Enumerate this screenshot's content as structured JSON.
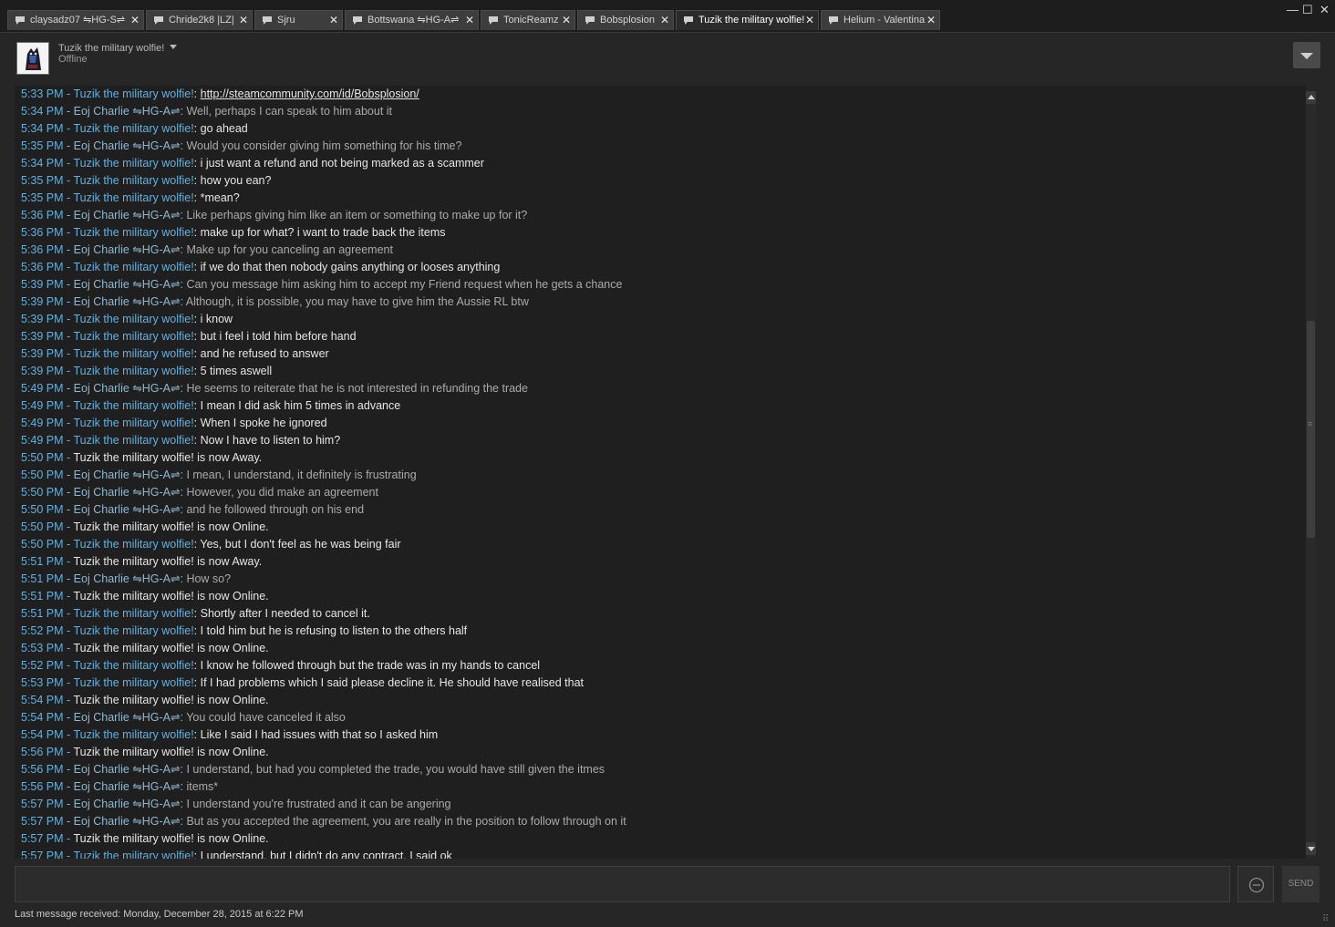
{
  "tabs": [
    {
      "label": "claysadz07 ⇋HG-S⇌",
      "width": 150,
      "active": false
    },
    {
      "label": "Chride2k8 |LZ|",
      "width": 117,
      "active": false
    },
    {
      "label": "Sjru",
      "width": 97,
      "active": false
    },
    {
      "label": "Bottswana ⇋HG-A⇌",
      "width": 147,
      "active": false
    },
    {
      "label": "TonicReamz",
      "width": 104,
      "active": false
    },
    {
      "label": "Bobsplosion",
      "width": 106,
      "active": false
    },
    {
      "label": "Tuzik the military wolfie!",
      "width": 157,
      "active": true
    },
    {
      "label": "Helium - Valentina",
      "width": 131,
      "active": false
    }
  ],
  "window_controls": {
    "minimize": "—",
    "maximize": "☐",
    "close": "✕"
  },
  "friend": {
    "name": "Tuzik the military wolfie!",
    "status": "Offline"
  },
  "messages": [
    {
      "time": "5:33 PM",
      "kind": "me",
      "name": "Tuzik the military wolfie!",
      "text": "http://steamcommunity.com/id/Bobsplosion/",
      "link": true
    },
    {
      "time": "5:34 PM",
      "kind": "other",
      "name": "Eoj Charlie ⇋HG-A⇌",
      "text": "Well, perhaps I can speak to him about it"
    },
    {
      "time": "5:34 PM",
      "kind": "me",
      "name": "Tuzik the military wolfie!",
      "text": "go ahead"
    },
    {
      "time": "5:35 PM",
      "kind": "other",
      "name": "Eoj Charlie ⇋HG-A⇌",
      "text": "Would you consider giving him something for his time?"
    },
    {
      "time": "5:34 PM",
      "kind": "me",
      "name": "Tuzik the military wolfie!",
      "text": "i just want a refund and not being marked as a scammer"
    },
    {
      "time": "5:35 PM",
      "kind": "me",
      "name": "Tuzik the military wolfie!",
      "text": "how you ean?"
    },
    {
      "time": "5:35 PM",
      "kind": "me",
      "name": "Tuzik the military wolfie!",
      "text": "*mean?"
    },
    {
      "time": "5:36 PM",
      "kind": "other",
      "name": "Eoj Charlie ⇋HG-A⇌",
      "text": "Like perhaps giving him like an item or something to make up for it?"
    },
    {
      "time": "5:36 PM",
      "kind": "me",
      "name": "Tuzik the military wolfie!",
      "text": "make up for what? i want to trade back the items"
    },
    {
      "time": "5:36 PM",
      "kind": "other",
      "name": "Eoj Charlie ⇋HG-A⇌",
      "text": "Make up for you canceling an agreement"
    },
    {
      "time": "5:36 PM",
      "kind": "me",
      "name": "Tuzik the military wolfie!",
      "text": "if we do that then nobody gains anything or looses anything"
    },
    {
      "time": "5:39 PM",
      "kind": "other",
      "name": "Eoj Charlie ⇋HG-A⇌",
      "text": "Can you message him asking him to accept my Friend request when he gets a chance"
    },
    {
      "time": "5:39 PM",
      "kind": "other",
      "name": "Eoj Charlie ⇋HG-A⇌",
      "text": "Although, it is possible, you may have to give him the Aussie RL btw"
    },
    {
      "time": "5:39 PM",
      "kind": "me",
      "name": "Tuzik the military wolfie!",
      "text": "i know"
    },
    {
      "time": "5:39 PM",
      "kind": "me",
      "name": "Tuzik the military wolfie!",
      "text": "but i feel i told him before hand"
    },
    {
      "time": "5:39 PM",
      "kind": "me",
      "name": "Tuzik the military wolfie!",
      "text": "and he refused to answer"
    },
    {
      "time": "5:39 PM",
      "kind": "me",
      "name": "Tuzik the military wolfie!",
      "text": "5 times aswell"
    },
    {
      "time": "5:49 PM",
      "kind": "other",
      "name": "Eoj Charlie ⇋HG-A⇌",
      "text": "He seems to reiterate that he is not interested in refunding the trade"
    },
    {
      "time": "5:49 PM",
      "kind": "me",
      "name": "Tuzik the military wolfie!",
      "text": "I mean I did ask him 5 times in advance"
    },
    {
      "time": "5:49 PM",
      "kind": "me",
      "name": "Tuzik the military wolfie!",
      "text": "When I spoke he ignored"
    },
    {
      "time": "5:49 PM",
      "kind": "me",
      "name": "Tuzik the military wolfie!",
      "text": "Now I have to listen to him?"
    },
    {
      "time": "5:50 PM",
      "kind": "sys",
      "text": "Tuzik the military wolfie! is now Away."
    },
    {
      "time": "5:50 PM",
      "kind": "other",
      "name": "Eoj Charlie ⇋HG-A⇌",
      "text": "I mean, I understand, it definitely is frustrating"
    },
    {
      "time": "5:50 PM",
      "kind": "other",
      "name": "Eoj Charlie ⇋HG-A⇌",
      "text": "However, you did make an agreement"
    },
    {
      "time": "5:50 PM",
      "kind": "other",
      "name": "Eoj Charlie ⇋HG-A⇌",
      "text": "and he followed through on his end"
    },
    {
      "time": "5:50 PM",
      "kind": "sys",
      "text": "Tuzik the military wolfie! is now Online."
    },
    {
      "time": "5:50 PM",
      "kind": "me",
      "name": "Tuzik the military wolfie!",
      "text": "Yes, but I don't feel as he was being fair"
    },
    {
      "time": "5:51 PM",
      "kind": "sys",
      "text": "Tuzik the military wolfie! is now Away."
    },
    {
      "time": "5:51 PM",
      "kind": "other",
      "name": "Eoj Charlie ⇋HG-A⇌",
      "text": "How so?"
    },
    {
      "time": "5:51 PM",
      "kind": "sys",
      "text": "Tuzik the military wolfie! is now Online."
    },
    {
      "time": "5:51 PM",
      "kind": "me",
      "name": "Tuzik the military wolfie!",
      "text": "Shortly after I needed to cancel it."
    },
    {
      "time": "5:52 PM",
      "kind": "me",
      "name": "Tuzik the military wolfie!",
      "text": "I told him but he is refusing to listen to the others half"
    },
    {
      "time": "5:53 PM",
      "kind": "sys",
      "text": "Tuzik the military wolfie! is now Online."
    },
    {
      "time": "5:52 PM",
      "kind": "me",
      "name": "Tuzik the military wolfie!",
      "text": "I know he followed through but the trade was in my hands to cancel"
    },
    {
      "time": "5:53 PM",
      "kind": "me",
      "name": "Tuzik the military wolfie!",
      "text": "If I had problems which I said please decline it. He should have realised that"
    },
    {
      "time": "5:54 PM",
      "kind": "sys",
      "text": "Tuzik the military wolfie! is now Online."
    },
    {
      "time": "5:54 PM",
      "kind": "other",
      "name": "Eoj Charlie ⇋HG-A⇌",
      "text": "You could have canceled it also"
    },
    {
      "time": "5:54 PM",
      "kind": "me",
      "name": "Tuzik the military wolfie!",
      "text": "Like I said I had issues with that so I asked him"
    },
    {
      "time": "5:56 PM",
      "kind": "sys",
      "text": "Tuzik the military wolfie! is now Online."
    },
    {
      "time": "5:56 PM",
      "kind": "other",
      "name": "Eoj Charlie ⇋HG-A⇌",
      "text": "I understand, but had you completed the trade, you would have still given the itmes"
    },
    {
      "time": "5:56 PM",
      "kind": "other",
      "name": "Eoj Charlie ⇋HG-A⇌",
      "text": "items*"
    },
    {
      "time": "5:57 PM",
      "kind": "other",
      "name": "Eoj Charlie ⇋HG-A⇌",
      "text": "I understand you're frustrated and it can be angering"
    },
    {
      "time": "5:57 PM",
      "kind": "other",
      "name": "Eoj Charlie ⇋HG-A⇌",
      "text": "But as you accepted the agreement, you are really in the position to follow through on it"
    },
    {
      "time": "5:57 PM",
      "kind": "sys",
      "text": "Tuzik the military wolfie! is now Online."
    },
    {
      "time": "5:57 PM",
      "kind": "me",
      "name": "Tuzik the military wolfie!",
      "text": "I understand, but I didn't do any contract, I said ok"
    }
  ],
  "composer": {
    "value": "",
    "placeholder": "",
    "send_label": "SEND"
  },
  "footer": {
    "last_message": "Last message received: Monday, December 28, 2015 at 6:22 PM"
  },
  "colors": {
    "timestamp": "#62b1e0",
    "my_name": "#62b1e0",
    "other_name": "#8fb8d1",
    "my_text": "#e6e6e6",
    "other_text": "#aaaaaa",
    "background": "#262626"
  }
}
